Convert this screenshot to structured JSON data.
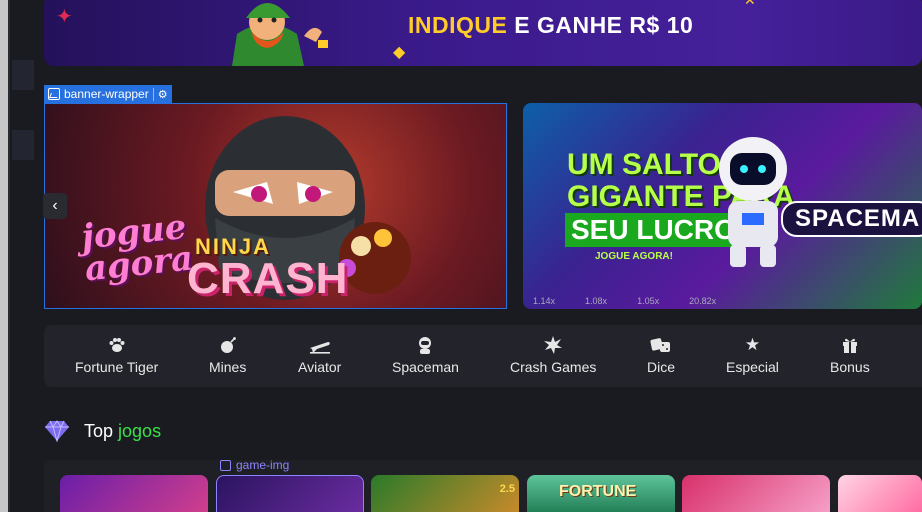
{
  "promo_banner": {
    "highlight_text": "INDIQUE",
    "rest_text": " E GANHE R$ 10"
  },
  "debug_labels": {
    "banner_wrapper": "banner-wrapper",
    "game_img": "game-img"
  },
  "carousel": {
    "ninja": {
      "line1": "jogue",
      "line2": "agora",
      "game_small": "NINJA",
      "game_big": "CRASH"
    },
    "spaceman": {
      "headline_1": "UM SALTO",
      "headline_2": "GIGANTE PARA",
      "headline_box": "SEU LUCRO",
      "subtitle": "JOGUE AGORA!",
      "logo": "SPACEMA",
      "stats": [
        "1.14x",
        "1.08x",
        "1.05x",
        "20.82x"
      ]
    }
  },
  "categories": [
    {
      "label": "Fortune Tiger",
      "icon": "paw-icon"
    },
    {
      "label": "Mines",
      "icon": "bomb-icon"
    },
    {
      "label": "Aviator",
      "icon": "plane-icon"
    },
    {
      "label": "Spaceman",
      "icon": "astronaut-icon"
    },
    {
      "label": "Crash Games",
      "icon": "explosion-icon"
    },
    {
      "label": "Dice",
      "icon": "dice-icon"
    },
    {
      "label": "Especial",
      "icon": "star-icon"
    },
    {
      "label": "Bonus",
      "icon": "gift-icon"
    }
  ],
  "top_games": {
    "title_main": "Top ",
    "title_accent": "jogos",
    "card_texts": [
      "2.5",
      "FORTUNE"
    ]
  },
  "colors": {
    "accent_green": "#39e14a",
    "promo_yellow": "#ffcc2a",
    "selection_blue": "#2670e0"
  }
}
